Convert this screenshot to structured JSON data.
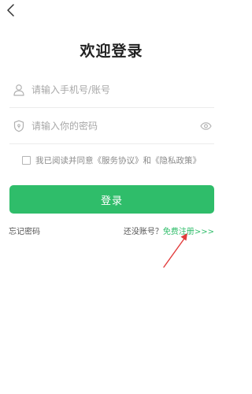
{
  "header": {
    "back_icon": "chevron-left-icon",
    "title": "欢迎登录"
  },
  "form": {
    "phone": {
      "icon": "user-icon",
      "placeholder": "请输入手机号/账号",
      "value": ""
    },
    "password": {
      "icon": "shield-icon",
      "placeholder": "请输入你的密码",
      "value": "",
      "toggle_icon": "eye-icon"
    }
  },
  "agreement": {
    "checked": false,
    "prefix": "我已阅读并同意",
    "service_link": "《服务协议》",
    "and": "和",
    "privacy_link": "《隐私政策》"
  },
  "login_button": "登录",
  "links": {
    "forgot_password": "忘记密码",
    "no_account": "还没账号？",
    "register": "免费注册>>>"
  },
  "colors": {
    "accent": "#2fbd6a",
    "annotation": "#e23b3b"
  }
}
